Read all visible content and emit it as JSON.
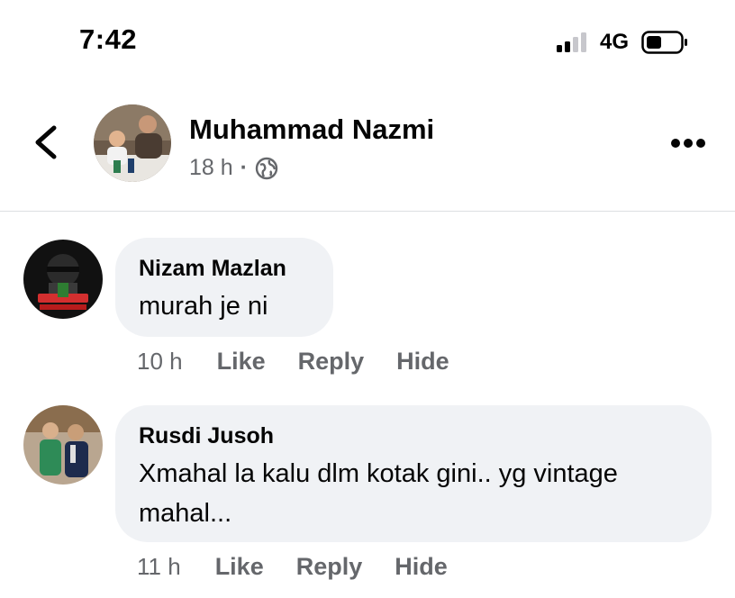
{
  "status_bar": {
    "time": "7:42",
    "network": "4G"
  },
  "post": {
    "author": "Muhammad Nazmi",
    "age": "18 h",
    "separator": "·",
    "audience_icon": "globe-icon"
  },
  "comments": [
    {
      "author": "Nizam Mazlan",
      "text": "murah je ni",
      "time": "10 h",
      "like": "Like",
      "reply": "Reply",
      "hide": "Hide"
    },
    {
      "author": "Rusdi Jusoh",
      "text": "Xmahal la kalu dlm kotak gini.. yg vintage mahal...",
      "time": "11 h",
      "like": "Like",
      "reply": "Reply",
      "hide": "Hide"
    }
  ],
  "colors": {
    "bubble": "#f0f2f5",
    "secondary_text": "#65676b",
    "primary_text": "#050505",
    "divider": "#dddfe2"
  }
}
